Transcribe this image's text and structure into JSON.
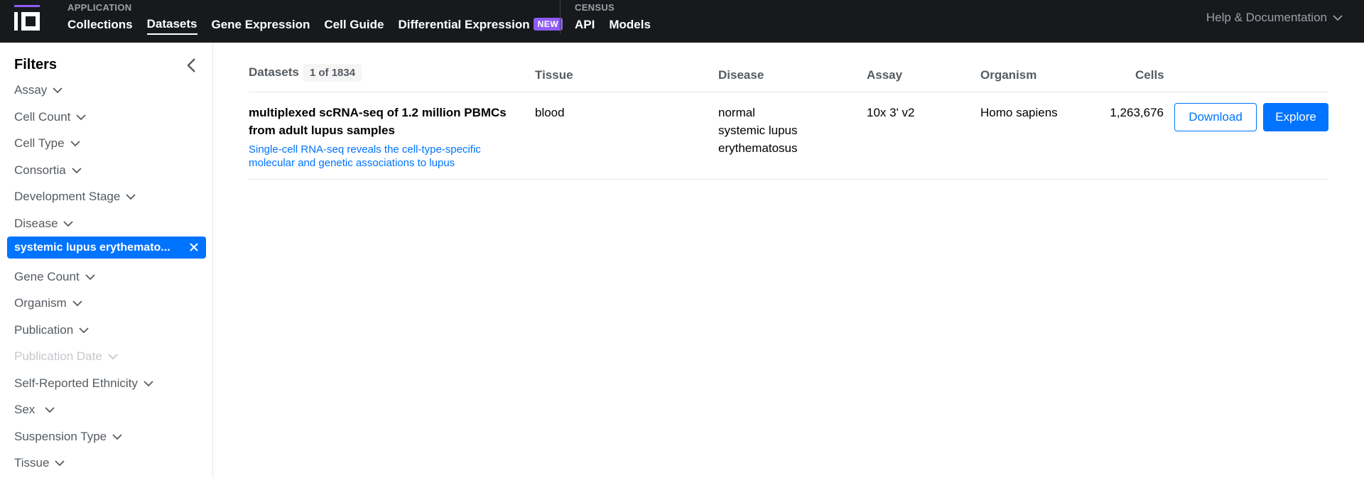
{
  "topbar": {
    "application_caption": "APPLICATION",
    "application_links": [
      {
        "label": "Collections"
      },
      {
        "label": "Datasets"
      },
      {
        "label": "Gene Expression"
      },
      {
        "label": "Cell Guide"
      },
      {
        "label": "Differential Expression"
      }
    ],
    "new_badge": "NEW",
    "census_caption": "CENSUS",
    "census_links": [
      {
        "label": "API"
      },
      {
        "label": "Models"
      }
    ],
    "help_label": "Help & Documentation"
  },
  "sidebar": {
    "title": "Filters",
    "filters": [
      {
        "label": "Assay"
      },
      {
        "label": "Cell Count"
      },
      {
        "label": "Cell Type"
      },
      {
        "label": "Consortia"
      },
      {
        "label": "Development Stage"
      },
      {
        "label": "Disease"
      },
      {
        "label": "Gene Count"
      },
      {
        "label": "Organism"
      },
      {
        "label": "Publication"
      },
      {
        "label": "Publication Date"
      },
      {
        "label": "Self-Reported Ethnicity"
      },
      {
        "label": "Sex"
      },
      {
        "label": "Suspension Type"
      },
      {
        "label": "Tissue"
      }
    ],
    "selected_chip": "systemic lupus erythemato..."
  },
  "table": {
    "headers": {
      "datasets": "Datasets",
      "count": "1 of 1834",
      "tissue": "Tissue",
      "disease": "Disease",
      "assay": "Assay",
      "organism": "Organism",
      "cells": "Cells"
    },
    "rows": [
      {
        "title_line1": "multiplexed scRNA-seq of 1.2 million PBMCs",
        "title_line2": "from adult lupus samples",
        "link_line1": "Single-cell RNA-seq reveals the cell-type-specific",
        "link_line2": "molecular and genetic associations to lupus",
        "tissue": "blood",
        "disease_line1": "normal",
        "disease_line2": "systemic lupus",
        "disease_line3": "erythematosus",
        "assay": "10x 3' v2",
        "organism": "Homo sapiens",
        "cells": "1,263,676",
        "download_label": "Download",
        "explore_label": "Explore"
      }
    ]
  },
  "colors": {
    "topbar_bg": "#171a1d",
    "accent_blue": "#0073ff",
    "brand_purple": "#8f5cf5"
  }
}
